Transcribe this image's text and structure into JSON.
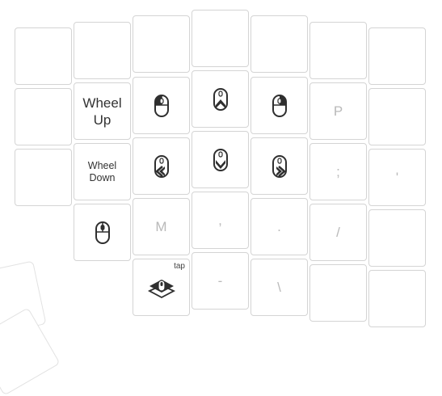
{
  "keys": {
    "r1c3": {
      "label": "Wheel Up",
      "line1": "Wheel",
      "line2": "Up"
    },
    "r1c4": {
      "icon": "mouse-left-click-icon"
    },
    "r1c5": {
      "icon": "mouse-move-up-icon"
    },
    "r1c6": {
      "icon": "mouse-right-click-icon"
    },
    "r1c7": {
      "label": "P"
    },
    "r2c3": {
      "label": "Wheel Down",
      "line1": "Wheel",
      "line2": "Down"
    },
    "r2c4": {
      "icon": "mouse-move-left-icon"
    },
    "r2c5": {
      "icon": "mouse-move-down-icon"
    },
    "r2c6": {
      "icon": "mouse-move-right-icon"
    },
    "r2c7": {
      "label": ";"
    },
    "r2c8": {
      "label": "'"
    },
    "r3c3": {
      "icon": "mouse-middle-click-icon"
    },
    "r3c4": {
      "label": "M"
    },
    "r3c5": {
      "label": ","
    },
    "r3c6": {
      "label": "."
    },
    "r3c7": {
      "label": "/"
    },
    "r4c4": {
      "icon": "mouse-layer-icon",
      "hold": "tap"
    },
    "r4c5": {
      "label": "-"
    },
    "r4c6": {
      "label": "\\"
    }
  },
  "colors": {
    "key_border": "#d4d4d4",
    "icon": "#2f2f2f",
    "dim_text": "#b9b9b9"
  }
}
